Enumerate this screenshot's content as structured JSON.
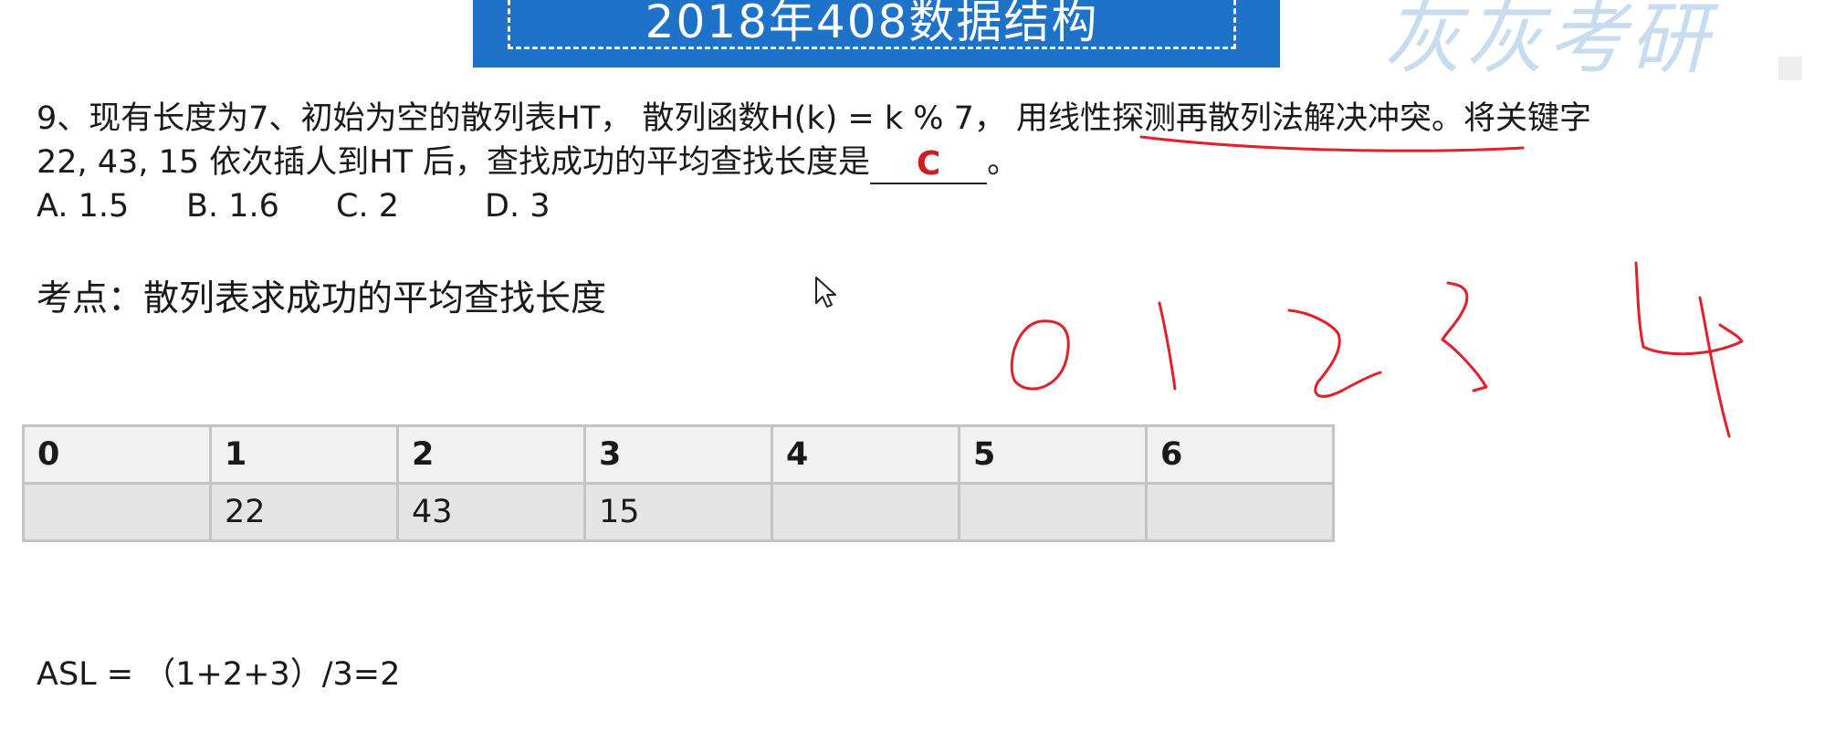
{
  "banner": {
    "title": "2018年408数据结构"
  },
  "watermark": {
    "text": "灰灰考研"
  },
  "question": {
    "line1_before": "9、现有长度为7、初始为空的散列表HT， 散列函数H(k) = k % 7， 用",
    "line1_underlined": "线性探测再散列法解决冲突",
    "line1_after": "。将关键字",
    "line2_before": "22, 43, 15 依次插人到HT 后，查找成功的平均查找长度是",
    "answer": "C",
    "line2_after": "。"
  },
  "options": [
    "A. 1.5",
    "B. 1.6",
    "C. 2",
    "D. 3"
  ],
  "keypoint": "考点：散列表求成功的平均查找长度",
  "hash_table": {
    "indices": [
      "0",
      "1",
      "2",
      "3",
      "4",
      "5",
      "6"
    ],
    "values": [
      "",
      "22",
      "43",
      "15",
      "",
      "",
      ""
    ]
  },
  "handwriting": {
    "digits": [
      "0",
      "1",
      "2",
      "3",
      "4"
    ],
    "color": "#e0202a"
  },
  "asl": "ASL = （1+2+3）/3=2"
}
